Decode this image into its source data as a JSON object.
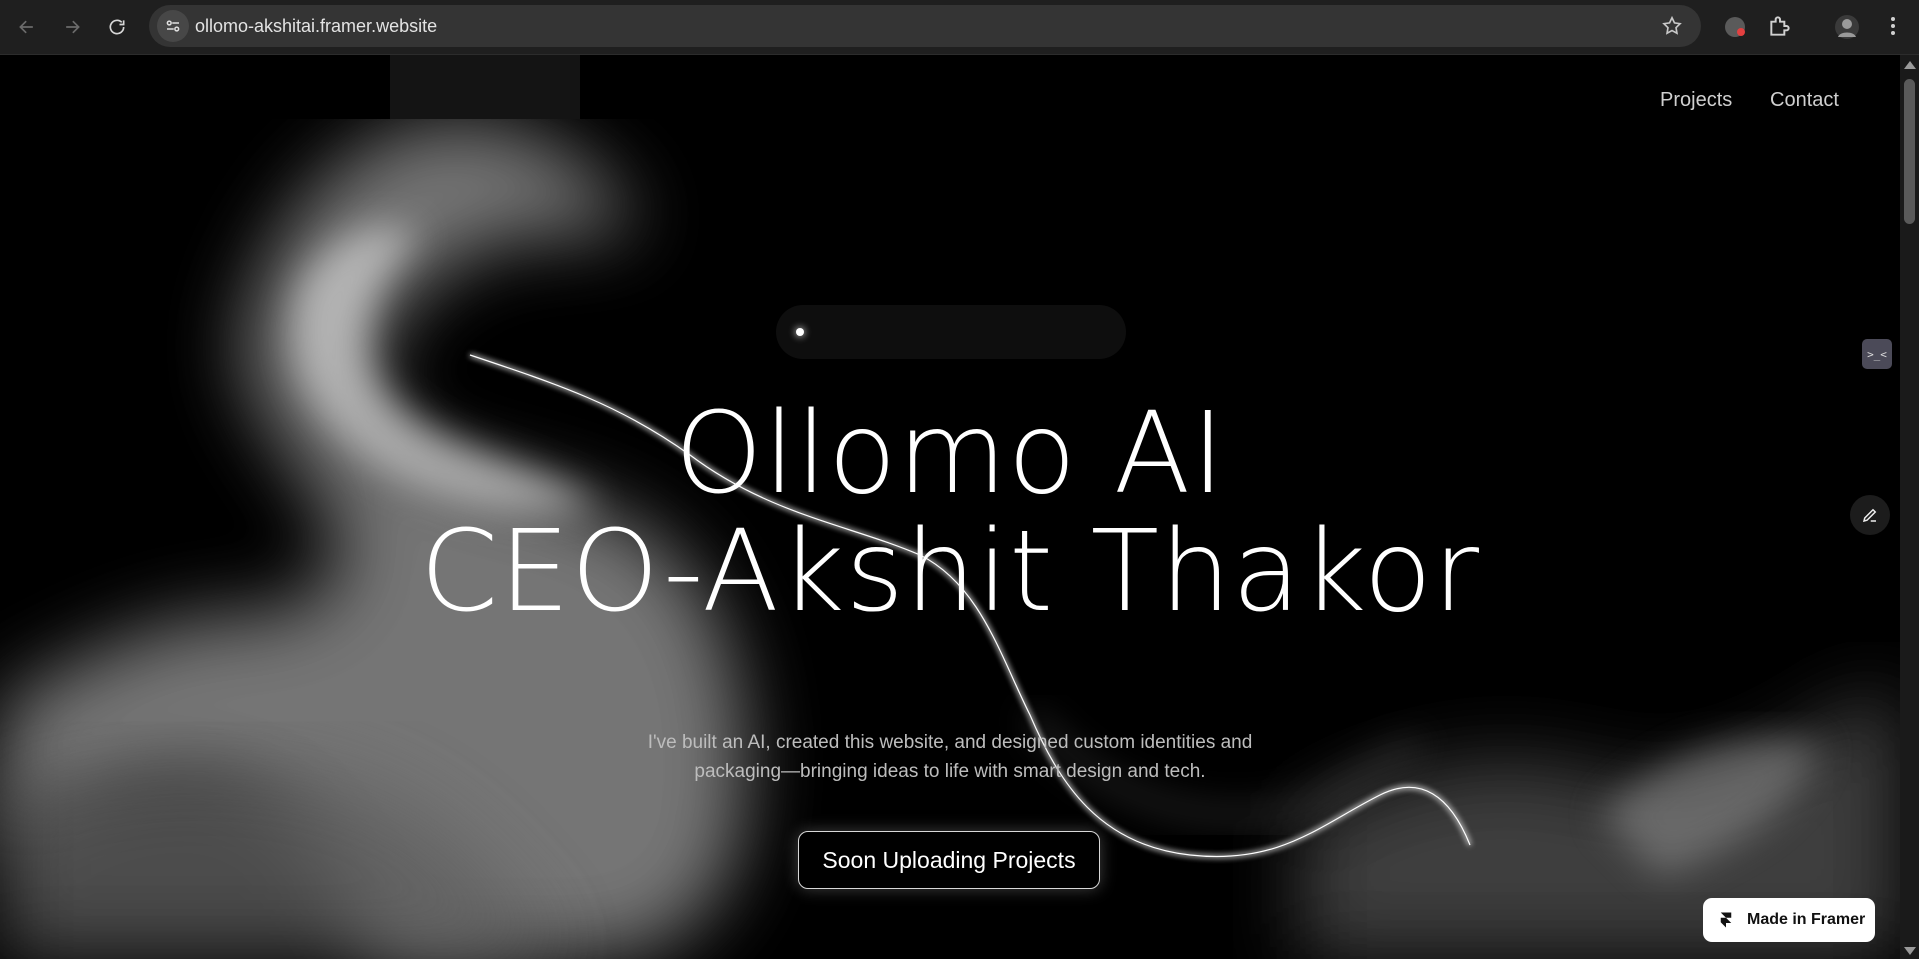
{
  "browser": {
    "url": "ollomo-akshitai.framer.website"
  },
  "nav": {
    "projects": "Projects",
    "contact": "Contact"
  },
  "hero": {
    "line1": "Ollomo AI",
    "line2": "CEO-Akshit Thakor",
    "subtitle_line1": "I've built an AI, created this website, and designed custom identities and",
    "subtitle_line2": "packaging—bringing ideas to life with smart design and tech.",
    "cta": "Soon Uploading Projects"
  },
  "side_badge": ">_<",
  "framer_badge": "Made in Framer",
  "colors": {
    "page_bg": "#000000",
    "chrome_bg": "#1f1f1f",
    "omnibox_bg": "#343434",
    "text_primary": "#ffffff",
    "text_muted": "#bdbdbd"
  },
  "icons": [
    "back-arrow-icon",
    "forward-arrow-icon",
    "reload-icon",
    "site-info-icon",
    "star-icon",
    "extension-icon",
    "puzzle-icon",
    "profile-avatar-icon",
    "menu-dots-icon",
    "edit-pencil-icon",
    "framer-logo-icon"
  ]
}
